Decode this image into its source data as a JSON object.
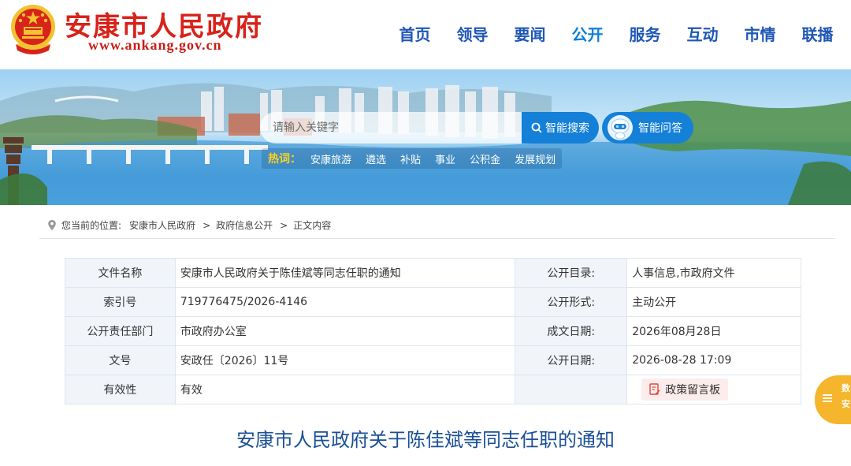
{
  "header": {
    "site_name": "安康市人民政府",
    "site_domain": "www.ankang.gov.cn",
    "nav": [
      {
        "label": "首页"
      },
      {
        "label": "领导"
      },
      {
        "label": "要闻"
      },
      {
        "label": "公开"
      },
      {
        "label": "服务"
      },
      {
        "label": "互动"
      },
      {
        "label": "市情"
      },
      {
        "label": "联播"
      }
    ],
    "active_nav": "公开"
  },
  "search": {
    "placeholder": "请输入关键字",
    "button_label": "智能搜索",
    "qa_label": "智能问答"
  },
  "hot_words": {
    "label": "热词：",
    "items": [
      "安康旅游",
      "遴选",
      "补贴",
      "事业",
      "公积金",
      "发展规划"
    ]
  },
  "breadcrumb": {
    "prefix": "您当前的位置:",
    "items": [
      "安康市人民政府",
      "政府信息公开",
      "正文内容"
    ],
    "separator": ">"
  },
  "info_table": {
    "rows": [
      {
        "label1": "文件名称",
        "value1": "安康市人民政府关于陈佳斌等同志任职的通知",
        "label2": "公开目录:",
        "value2": "人事信息,市政府文件"
      },
      {
        "label1": "索引号",
        "value1": "719776475/2026-4146",
        "label2": "公开形式:",
        "value2": "主动公开"
      },
      {
        "label1": "公开责任部门",
        "value1": "市政府办公室",
        "label2": "成文日期:",
        "value2": "2026年08月28日"
      },
      {
        "label1": "文号",
        "value1": "安政任〔2026〕11号",
        "label2": "公开日期:",
        "value2": "2026-08-28 17:09"
      },
      {
        "label1": "有效性",
        "value1": "有效",
        "label2": "",
        "value2": ""
      }
    ],
    "board_button": "政策留言板"
  },
  "article": {
    "title": "安康市人民政府关于陈佳斌等同志任职的通知"
  },
  "float_button": {
    "line1": "数",
    "line2": "安"
  },
  "colors": {
    "brand_red": "#d8231a",
    "nav_blue": "#1f57b6",
    "button_blue": "#1480d8",
    "title_blue": "#1a4f95",
    "hot_yellow": "#ffd21e",
    "float_orange": "#f5b52c"
  }
}
